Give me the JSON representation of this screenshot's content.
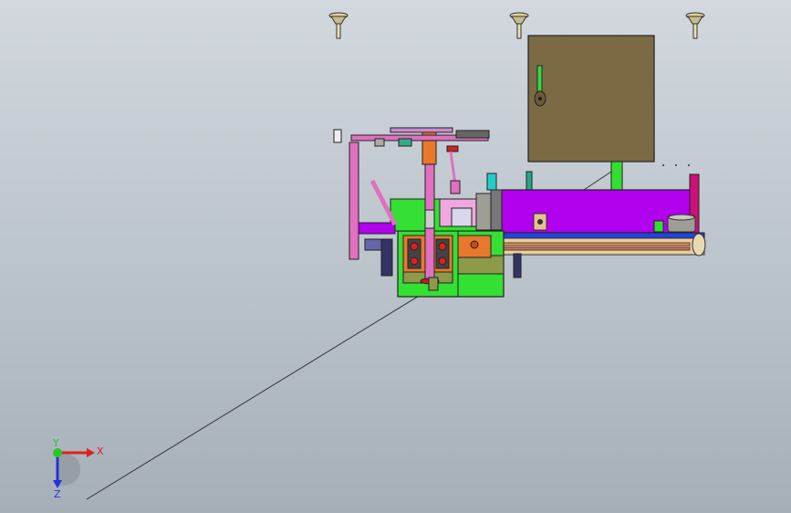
{
  "viewport": {
    "background_top": "#d2d8de",
    "background_bottom": "#a6afb8"
  },
  "model": {
    "colors": {
      "cabinet": "#7b6a44",
      "frame_green": "#33e033",
      "purple": "#b000ee",
      "pink": "#e070c0",
      "orange": "#e8782a",
      "blue_belt": "#2244dd",
      "olive": "#8c9a4a",
      "tan_belt": "#e6cfa0",
      "cyan": "#22cccc",
      "red": "#e02020"
    }
  },
  "triad": {
    "x_label": "X",
    "y_label": "Y",
    "z_label": "Z",
    "x_color": "#e02020",
    "y_color": "#22cc22",
    "z_color": "#2233dd",
    "icon": "coordinate-triad-icon"
  }
}
